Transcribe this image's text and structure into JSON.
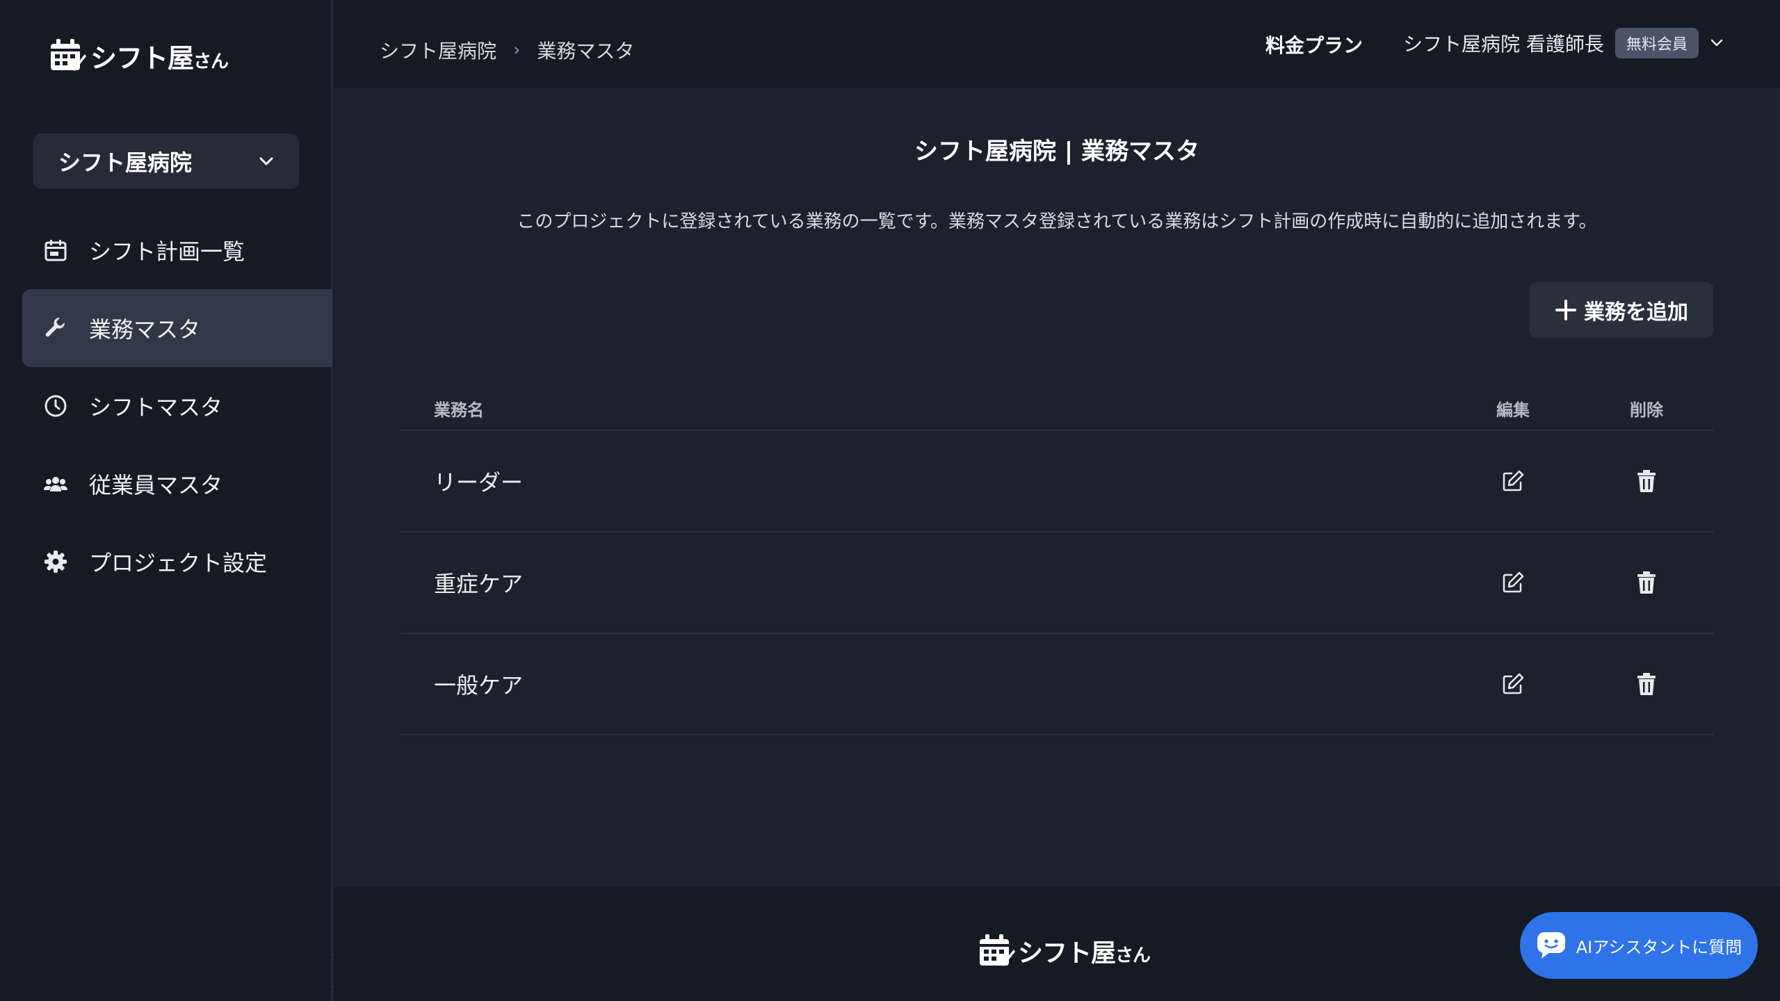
{
  "brand": {
    "name": "シフト屋",
    "suffix": "さん"
  },
  "sidebar": {
    "project": "シフト屋病院",
    "items": [
      {
        "label": "シフト計画一覧",
        "icon": "calendar-icon",
        "active": false
      },
      {
        "label": "業務マスタ",
        "icon": "wrench-icon",
        "active": true
      },
      {
        "label": "シフトマスタ",
        "icon": "clock-icon",
        "active": false
      },
      {
        "label": "従業員マスタ",
        "icon": "users-icon",
        "active": false
      },
      {
        "label": "プロジェクト設定",
        "icon": "gear-icon",
        "active": false
      }
    ]
  },
  "header": {
    "breadcrumb": [
      "シフト屋病院",
      "業務マスタ"
    ],
    "breadcrumb_sep": "›",
    "plan_label": "料金プラン",
    "user_name": "シフト屋病院 看護師長",
    "member_badge": "無料会員"
  },
  "main": {
    "title": "シフト屋病院 | 業務マスタ",
    "description": "このプロジェクトに登録されている業務の一覧です。業務マスタ登録されている業務はシフト計画の作成時に自動的に追加されます。",
    "add_button": "業務を追加",
    "table": {
      "headers": {
        "name": "業務名",
        "edit": "編集",
        "delete": "削除"
      },
      "rows": [
        {
          "name": "リーダー"
        },
        {
          "name": "重症ケア"
        },
        {
          "name": "一般ケア"
        }
      ]
    }
  },
  "assistant": {
    "label": "AIアシスタントに質問"
  },
  "colors": {
    "accent": "#2f73e8",
    "sidebar_bg": "#161a25",
    "main_bg": "#1d212d",
    "active_item": "#313948"
  }
}
